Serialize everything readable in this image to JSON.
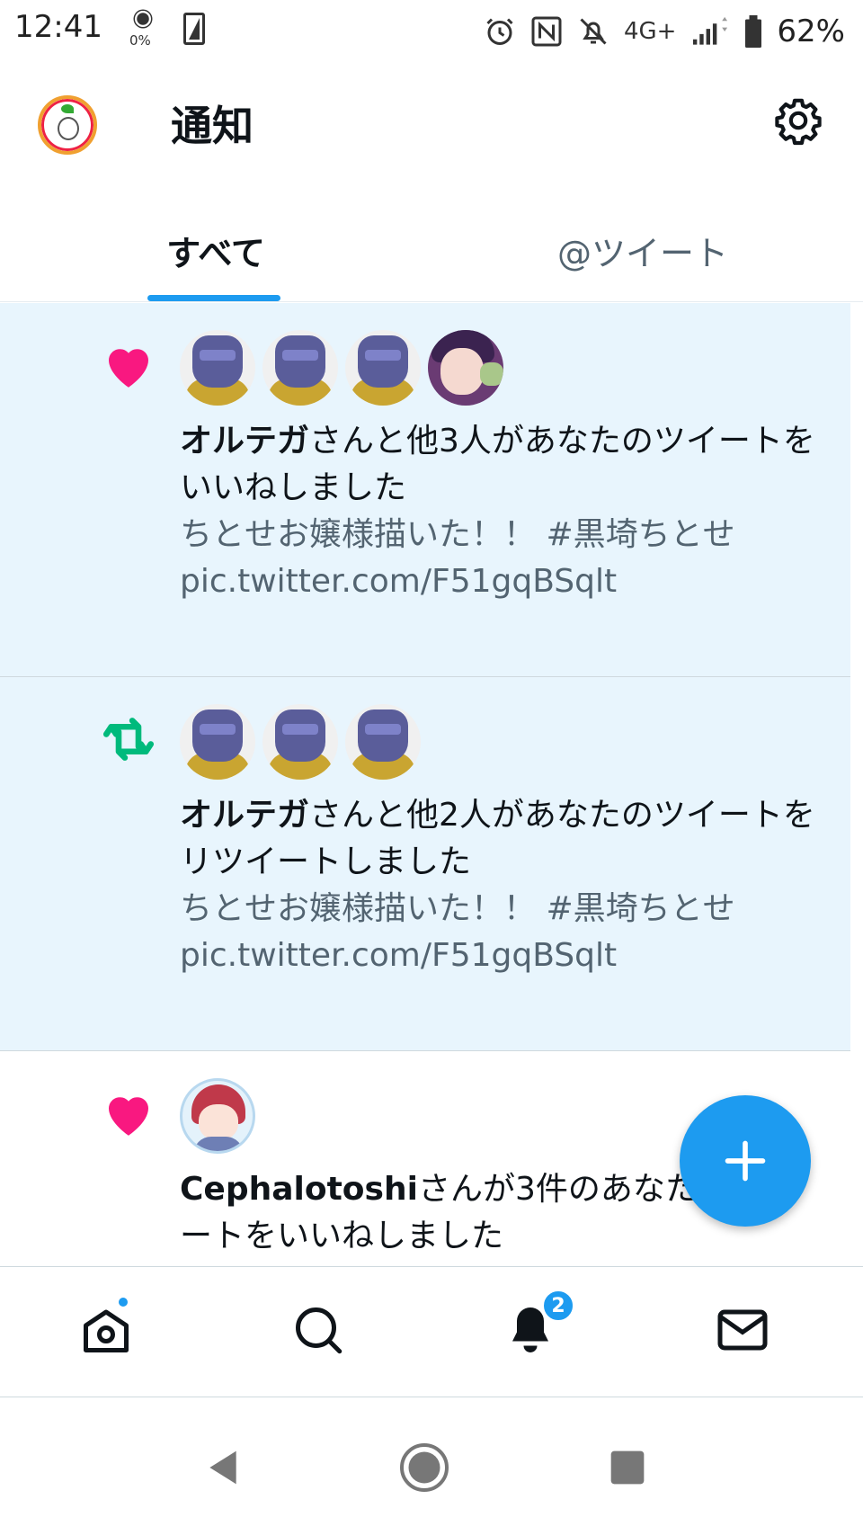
{
  "status_bar": {
    "time": "12:41",
    "brightness_pct": "0%",
    "network": "4G+",
    "battery": "62%"
  },
  "header": {
    "title": "通知"
  },
  "tabs": [
    {
      "label": "すべて",
      "active": true
    },
    {
      "label": "@ツイート",
      "active": false
    }
  ],
  "notifications": [
    {
      "type": "like",
      "icon": "heart-icon",
      "icon_color": "#f91880",
      "unread": true,
      "avatar_count": 4,
      "actor": "オルテガ",
      "text_rest": "さんと他3人があなたのツイートをいいねしました",
      "snippet": "ちとせお嬢様描いた！！ #黒埼ちとせ pic.twitter.com/F51gqBSqlt"
    },
    {
      "type": "retweet",
      "icon": "retweet-icon",
      "icon_color": "#00ba7c",
      "unread": true,
      "avatar_count": 3,
      "actor": "オルテガ",
      "text_rest": "さんと他2人があなたのツイートをリツイートしました",
      "snippet": "ちとせお嬢様描いた！！ #黒埼ちとせ pic.twitter.com/F51gqBSqlt"
    },
    {
      "type": "like",
      "icon": "heart-icon",
      "icon_color": "#f91880",
      "unread": false,
      "avatar_count": 1,
      "actor": "Cephalotoshi",
      "text_rest": "さんが3件のあなたのツイートをいいねしました"
    }
  ],
  "bottom_nav": {
    "items": [
      "home-icon",
      "search-icon",
      "bell-icon",
      "mail-icon"
    ],
    "notification_badge": "2"
  },
  "colors": {
    "accent": "#1d9bf0",
    "unread_bg": "#e8f5fd",
    "like": "#f91880",
    "retweet": "#00ba7c"
  }
}
